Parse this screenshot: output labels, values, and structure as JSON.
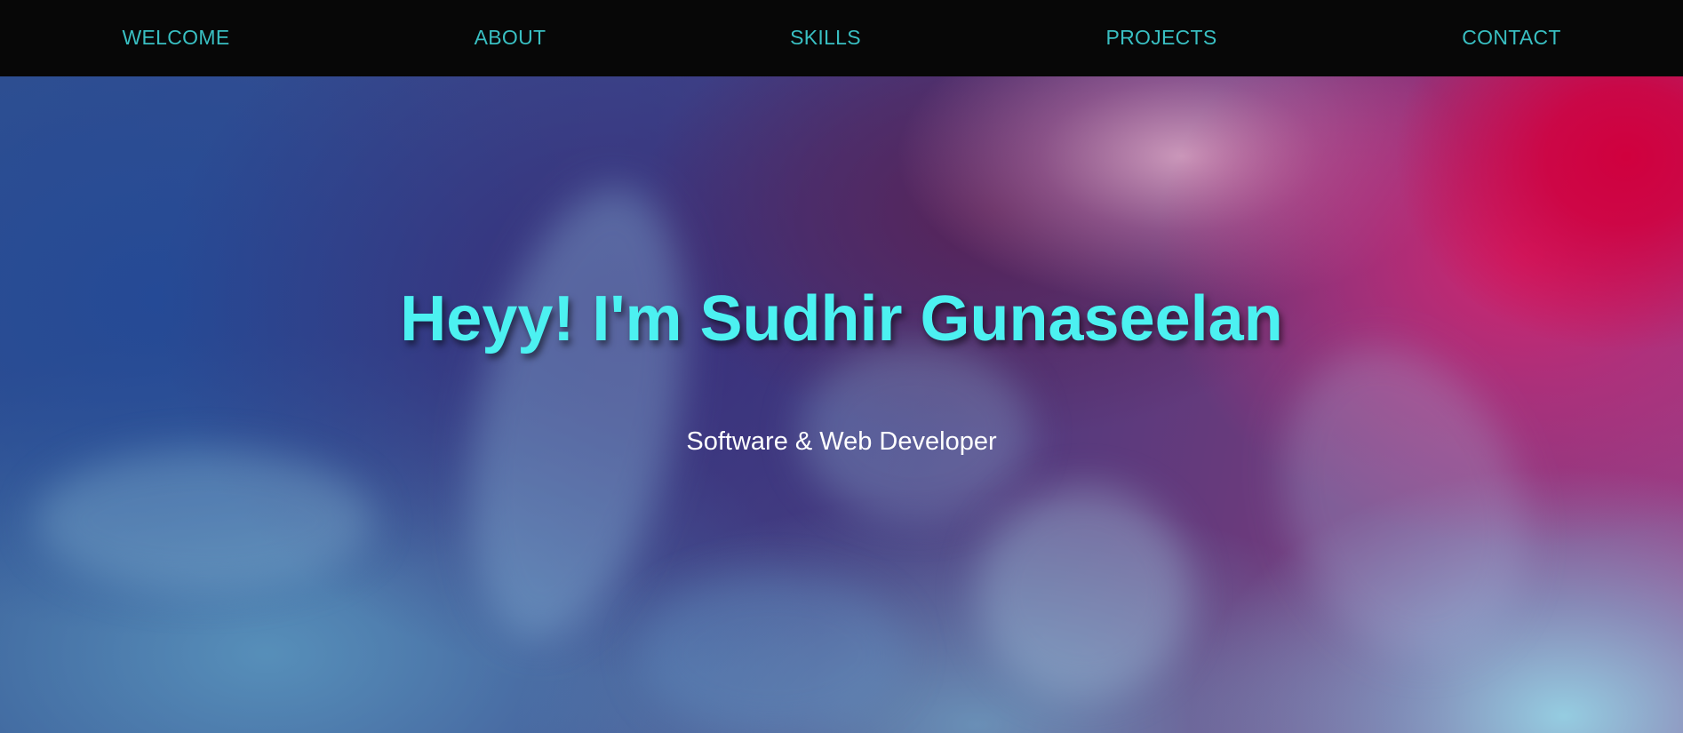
{
  "nav": {
    "items": [
      {
        "label": "WELCOME"
      },
      {
        "label": "ABOUT"
      },
      {
        "label": "SKILLS"
      },
      {
        "label": "PROJECTS"
      },
      {
        "label": "CONTACT"
      }
    ]
  },
  "hero": {
    "title": "Heyy! I'm Sudhir Gunaseelan",
    "subtitle": "Software & Web Developer"
  },
  "colors": {
    "nav_background": "#070707",
    "nav_text": "#39bfc2",
    "title_text": "#4cf1f1",
    "subtitle_text": "#ffffff"
  }
}
